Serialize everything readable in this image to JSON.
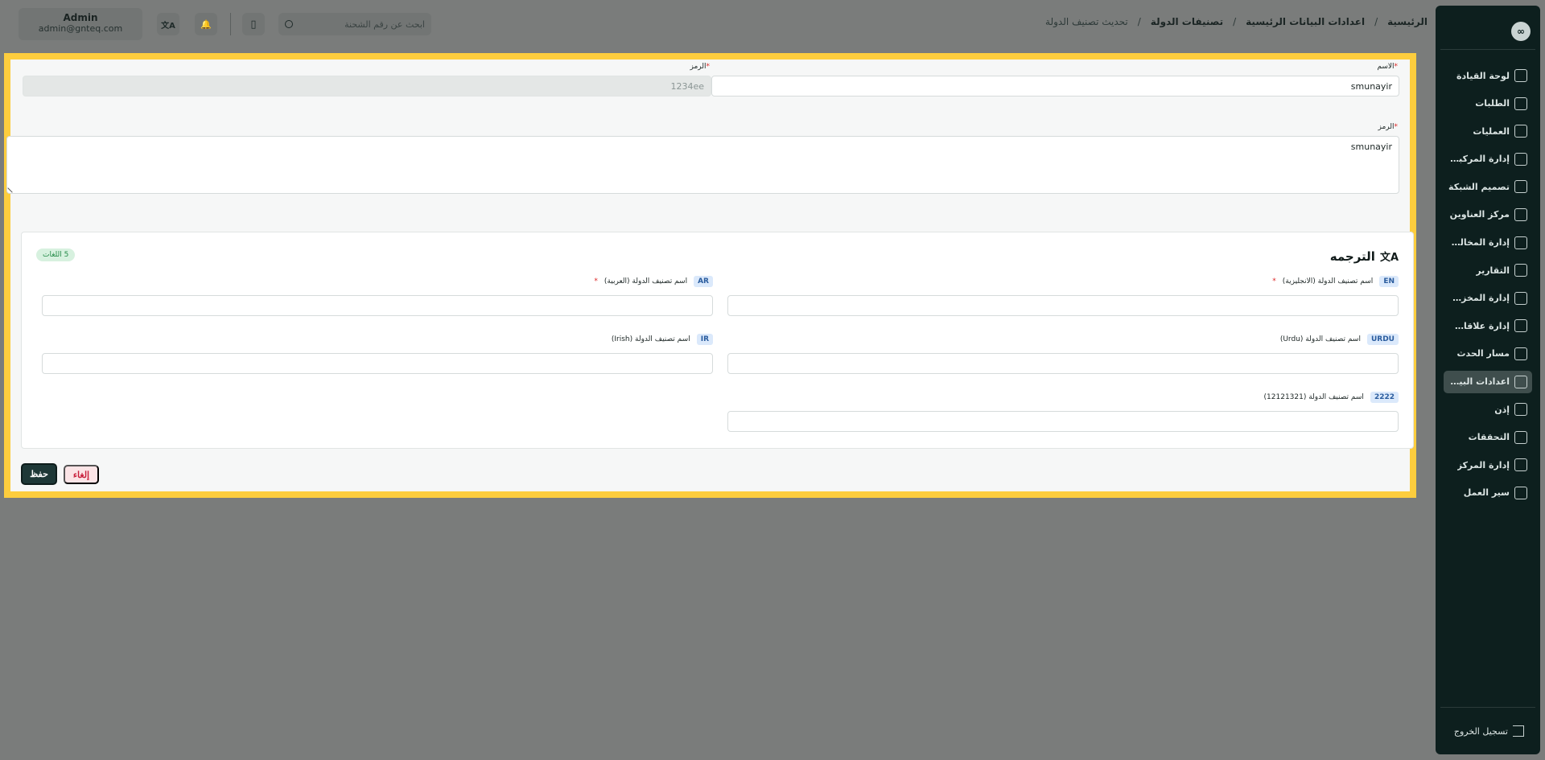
{
  "sidebar": {
    "logo": "∞",
    "items": [
      {
        "label": "لوحة القيادة",
        "icon": "dashboard-icon",
        "active": false
      },
      {
        "label": "الطلبات",
        "icon": "orders-icon",
        "active": false
      },
      {
        "label": "العمليات",
        "icon": "operations-icon",
        "active": false
      },
      {
        "label": "إدارة المركبات",
        "icon": "truck-icon",
        "active": false
      },
      {
        "label": "تصميم الشبكة",
        "icon": "network-icon",
        "active": false
      },
      {
        "label": "مركز العناوين",
        "icon": "address-icon",
        "active": false
      },
      {
        "label": "إدارة المخالفات",
        "icon": "violations-icon",
        "active": false
      },
      {
        "label": "التقارير",
        "icon": "reports-icon",
        "active": false
      },
      {
        "label": "إدارة المخزون",
        "icon": "inventory-icon",
        "active": false
      },
      {
        "label": "إدارة علاقات العملاء",
        "icon": "crm-icon",
        "active": false
      },
      {
        "label": "مسار الحدث",
        "icon": "event-path-icon",
        "active": false
      },
      {
        "label": "اعدادات البيانات...",
        "icon": "database-icon",
        "active": true
      },
      {
        "label": "إذن",
        "icon": "permissions-icon",
        "active": false
      },
      {
        "label": "التحققات",
        "icon": "validations-icon",
        "active": false
      },
      {
        "label": "إدارة المركز",
        "icon": "center-icon",
        "active": false
      },
      {
        "label": "سير العمل",
        "icon": "workflow-icon",
        "active": false
      }
    ],
    "logout_label": "تسجيل الخروج"
  },
  "header": {
    "breadcrumb": [
      "الرئيسية",
      "اعدادات البيانات الرئيسية",
      "تصنيفات الدولة",
      "تحديث تصنيف الدولة"
    ],
    "search_placeholder": "ابحث عن رقم الشحنة",
    "translate_icon": "文A",
    "bell_icon": "🔔",
    "tablet_icon": "▯",
    "user_name": "Admin",
    "user_email": "admin@gnteq.com"
  },
  "form": {
    "name_label": "الاسم",
    "name_value": "smunayir",
    "code_label": "الرمز",
    "code_value": "1234ee",
    "desc_label": "الرمز",
    "desc_value": "smunayir",
    "required_mark": "*"
  },
  "translation": {
    "title": "الترجمه",
    "title_icon": "文A",
    "count_badge": "5 اللغات",
    "fields": [
      {
        "tag": "EN",
        "label": "اسم تصنيف الدولة (الانجليزية)",
        "required": true,
        "value": ""
      },
      {
        "tag": "AR",
        "label": "اسم تصنيف الدولة (العربية)",
        "required": true,
        "value": ""
      },
      {
        "tag": "URDU",
        "label": "اسم تصنيف الدولة (Urdu)",
        "required": false,
        "value": ""
      },
      {
        "tag": "IR",
        "label": "اسم تصنيف الدولة (Irish)",
        "required": false,
        "value": ""
      },
      {
        "tag": "2222",
        "label": "اسم تصنيف الدولة (12121321)",
        "required": false,
        "value": ""
      }
    ]
  },
  "actions": {
    "save_label": "حفظ",
    "cancel_label": "إلغاء"
  },
  "colors": {
    "highlight_border": "#fdcd3e",
    "sidebar_bg": "#0d1f1e",
    "save_bg": "#1e3837",
    "cancel_text": "#c81e3a",
    "required": "#dc2626"
  }
}
